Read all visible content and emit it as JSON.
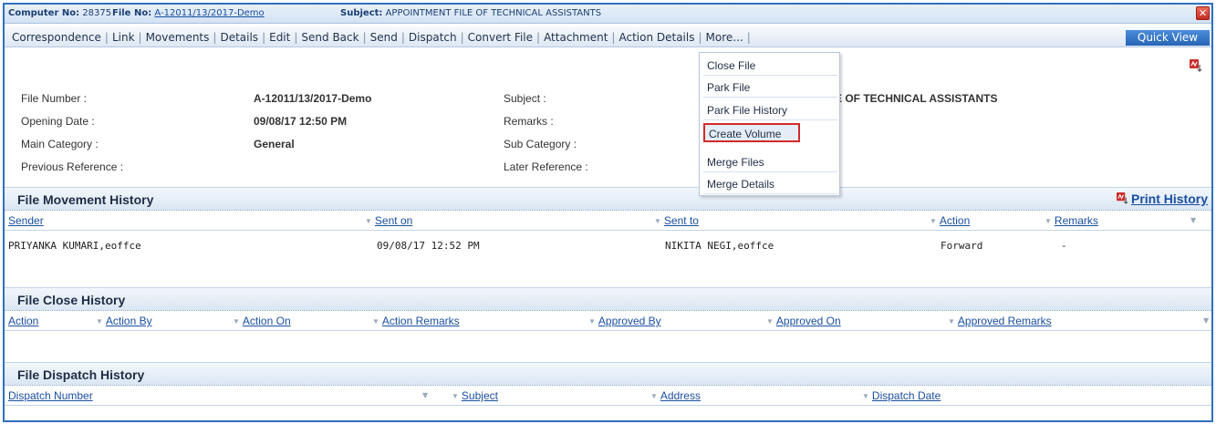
{
  "titlebar": {
    "computer_label": "Computer No:",
    "computer_no": "28375",
    "file_label": "File No:",
    "file_no": "A-12011/13/2017-Demo",
    "subject_label": "Subject:",
    "subject": "APPOINTMENT FILE OF TECHNICAL ASSISTANTS",
    "close_glyph": "✕"
  },
  "menubar": {
    "items": [
      "Correspondence",
      "Link",
      "Movements",
      "Details",
      "Edit",
      "Send Back",
      "Send",
      "Dispatch",
      "Convert File",
      "Attachment",
      "Action Details",
      "More..."
    ],
    "separator": "|",
    "quick_view": "Quick View"
  },
  "details": {
    "file_number_label": "File Number :",
    "file_number": "A-12011/13/2017-Demo",
    "opening_date_label": "Opening Date :",
    "opening_date": "09/08/17 12:50 PM",
    "main_category_label": "Main Category :",
    "main_category": "General",
    "previous_reference_label": "Previous Reference :",
    "subject_label": "Subject :",
    "subject_partial": "E OF TECHNICAL ASSISTANTS",
    "remarks_label": "Remarks :",
    "sub_category_label": "Sub Category :",
    "later_reference_label": "Later Reference :"
  },
  "more_menu": {
    "items": [
      "Close File",
      "Park File",
      "Park File History",
      "Create Volume",
      "Merge Files",
      "Merge Details"
    ],
    "highlighted": "Create Volume"
  },
  "movement_history": {
    "title": "File Movement History",
    "print_label": "Print History",
    "columns": [
      "Sender",
      "Sent on",
      "Sent to",
      "Action",
      "Remarks"
    ],
    "rows": [
      {
        "sender": "PRIYANKA KUMARI,eoffce",
        "sent_on": "09/08/17 12:52 PM",
        "sent_to": "NIKITA NEGI,eoffce",
        "action": "Forward",
        "remarks": "-"
      }
    ]
  },
  "close_history": {
    "title": "File Close History",
    "columns": [
      "Action",
      "Action By",
      "Action On",
      "Action Remarks",
      "Approved By",
      "Approved On",
      "Approved Remarks"
    ]
  },
  "dispatch_history": {
    "title": "File Dispatch History",
    "columns": [
      "Dispatch Number",
      "Subject",
      "Address",
      "Dispatch Date"
    ]
  },
  "colors": {
    "accent": "#2f6fbf",
    "link": "#1a4fa0",
    "highlight_border": "#d22a2a"
  }
}
